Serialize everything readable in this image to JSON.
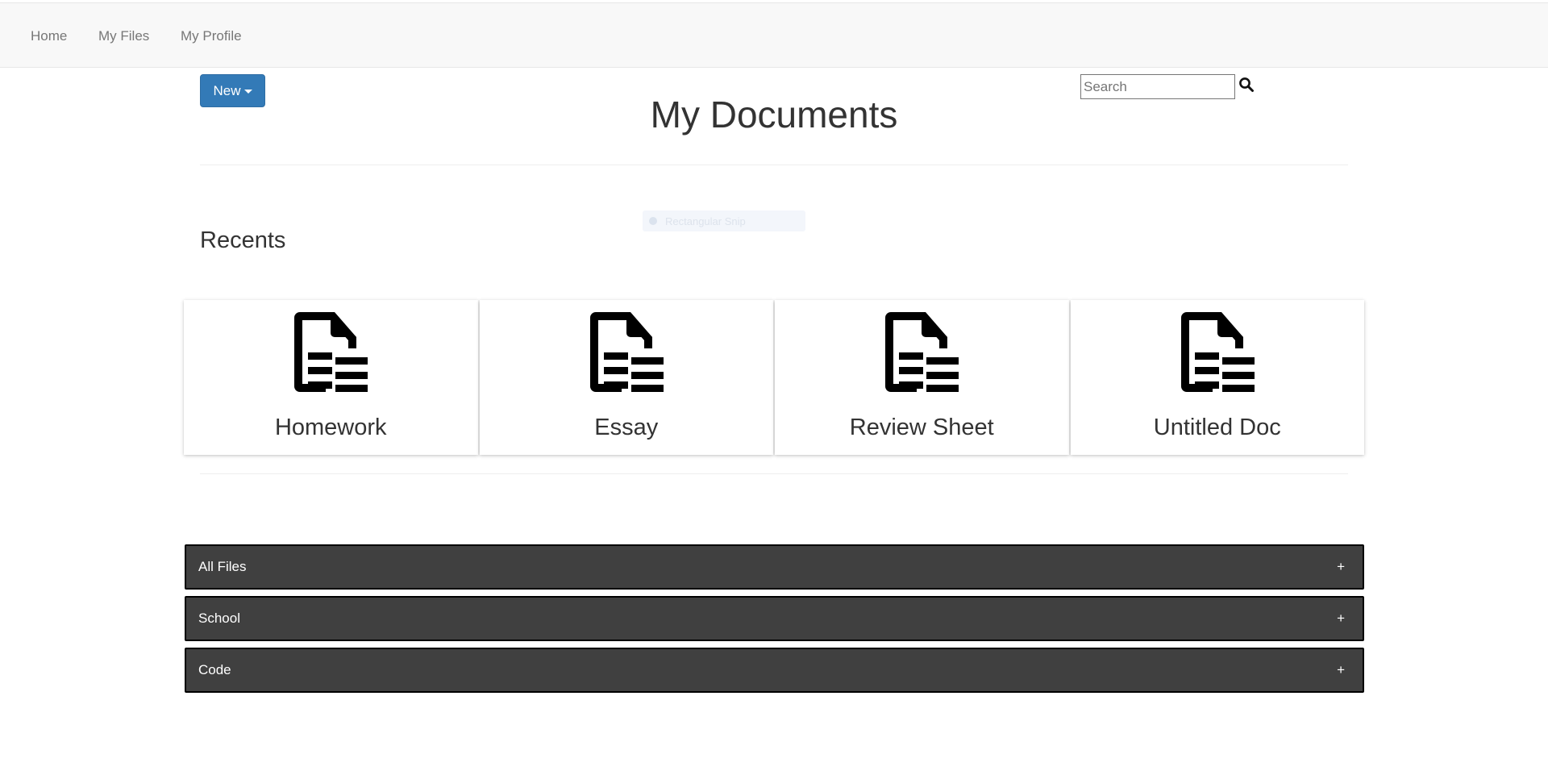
{
  "navbar": {
    "items": [
      {
        "label": "Home"
      },
      {
        "label": "My Files"
      },
      {
        "label": "My Profile"
      }
    ]
  },
  "toolbar": {
    "new_label": "New"
  },
  "page": {
    "title": "My Documents"
  },
  "search": {
    "placeholder": "Search",
    "value": ""
  },
  "ghost_item": {
    "label": "Rectangular Snip"
  },
  "recents": {
    "heading": "Recents",
    "docs": [
      {
        "title": "Homework",
        "icon": "document-icon"
      },
      {
        "title": "Essay",
        "icon": "document-icon"
      },
      {
        "title": "Review Sheet",
        "icon": "document-icon"
      },
      {
        "title": "Untitled Doc",
        "icon": "document-icon"
      }
    ]
  },
  "folders": [
    {
      "label": "All Files",
      "toggle": "+"
    },
    {
      "label": "School",
      "toggle": "+"
    },
    {
      "label": "Code",
      "toggle": "+"
    }
  ],
  "colors": {
    "primary": "#337ab7",
    "folder_bg": "#404040",
    "navbar_bg": "#f8f8f8"
  }
}
